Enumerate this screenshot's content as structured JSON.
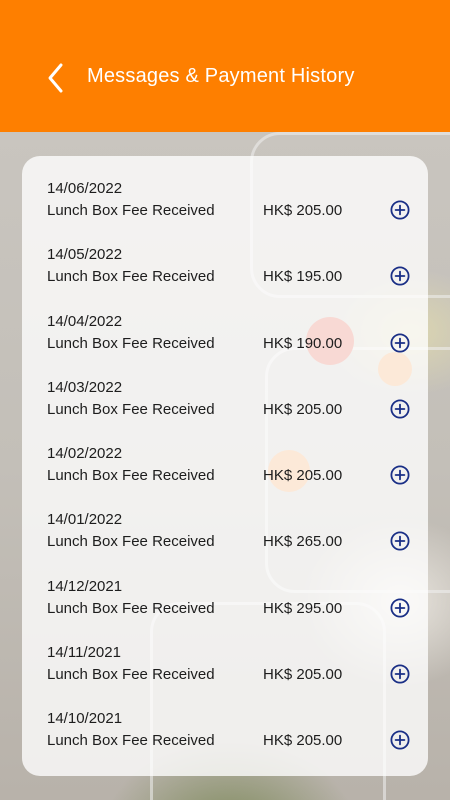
{
  "header": {
    "title": "Messages & Payment History",
    "back_icon": "chevron-left-icon",
    "background_color": "#fe7f00"
  },
  "payments": [
    {
      "date": "14/06/2022",
      "description": "Lunch Box Fee Received",
      "amount": "HK$ 205.00"
    },
    {
      "date": "14/05/2022",
      "description": "Lunch Box Fee Received",
      "amount": "HK$ 195.00"
    },
    {
      "date": "14/04/2022",
      "description": "Lunch Box Fee Received",
      "amount": "HK$ 190.00"
    },
    {
      "date": "14/03/2022",
      "description": "Lunch Box Fee Received",
      "amount": "HK$ 205.00"
    },
    {
      "date": "14/02/2022",
      "description": "Lunch Box Fee Received",
      "amount": "HK$ 205.00"
    },
    {
      "date": "14/01/2022",
      "description": "Lunch Box Fee Received",
      "amount": "HK$ 265.00"
    },
    {
      "date": "14/12/2021",
      "description": "Lunch Box Fee Received",
      "amount": "HK$ 295.00"
    },
    {
      "date": "14/11/2021",
      "description": "Lunch Box Fee Received",
      "amount": "HK$ 205.00"
    },
    {
      "date": "14/10/2021",
      "description": "Lunch Box Fee Received",
      "amount": "HK$ 205.00"
    }
  ],
  "row_action_icon": "plus-circle-icon",
  "colors": {
    "accent_icon": "#1a2f86",
    "text": "#1d1d1d"
  }
}
